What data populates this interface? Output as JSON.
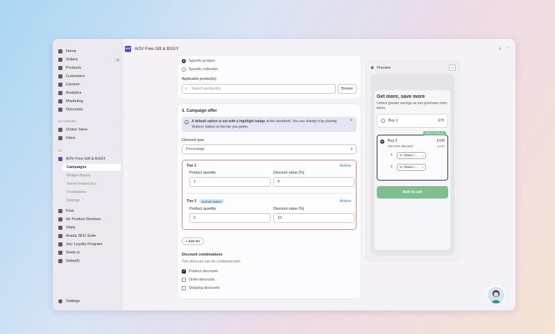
{
  "app": {
    "title": "AOV Free Gift & BXGY",
    "logo_text": "AOV"
  },
  "sidebar": {
    "items": [
      {
        "label": "Home",
        "icon": "home-icon"
      },
      {
        "label": "Orders",
        "icon": "orders-icon",
        "badge": "3"
      },
      {
        "label": "Products",
        "icon": "tag-icon"
      },
      {
        "label": "Customers",
        "icon": "person-icon"
      },
      {
        "label": "Content",
        "icon": "content-icon"
      },
      {
        "label": "Analytics",
        "icon": "chart-icon"
      },
      {
        "label": "Marketing",
        "icon": "target-icon"
      },
      {
        "label": "Discounts",
        "icon": "discount-icon"
      }
    ],
    "sales_channels_heading": "les channels",
    "channels": [
      {
        "label": "Online Store",
        "icon": "store-icon"
      },
      {
        "label": "Inbox",
        "icon": "inbox-icon"
      }
    ],
    "apps_heading": "ps",
    "current_app": {
      "label": "AOV Free Gift & BXGY"
    },
    "subitems": [
      "Campaigns",
      "Widget display",
      "Tiered reward bos",
      "Translations",
      "Settings"
    ],
    "apps": [
      {
        "label": "Flow"
      },
      {
        "label": "Air Product Reviews"
      },
      {
        "label": "Vitals"
      },
      {
        "label": "Avada SEO Suite"
      },
      {
        "label": "Joy: Loyalty Program"
      },
      {
        "label": "Smile.io"
      },
      {
        "label": "Salepify"
      }
    ],
    "settings": "Settings"
  },
  "applies_to": {
    "option_specific_product": "Specific product",
    "option_specific_collection": "Specific collection",
    "selected": "Specific product",
    "products_label": "Applicable product(s)",
    "search_placeholder": "Search product(s)",
    "browse": "Browse"
  },
  "campaign_offer": {
    "heading": "3. Campaign offer",
    "banner_bold": "A default option is set with a highlight badge",
    "banner_rest": " at the storefront. You can change it by clicking 'Actions' button on the tier you prefer.",
    "discount_type_label": "Discount type",
    "discount_type_value": "Percentage",
    "tiers": [
      {
        "title": "Tier 1",
        "badge": "",
        "actions": "Actions",
        "qty_label": "Product quantity",
        "qty": "1",
        "disc_label": "Discount value (%)",
        "disc": "0"
      },
      {
        "title": "Tier 2",
        "badge": "Default option",
        "actions": "Actions",
        "qty_label": "Product quantity",
        "qty": "2",
        "disc_label": "Discount value (%)",
        "disc": "10"
      }
    ],
    "add_tier": "+ Add tier",
    "combinations_heading": "Discount combinations",
    "combinations_sub": "This discount can be combined with:",
    "combinations": [
      {
        "label": "Product discounts",
        "checked": true
      },
      {
        "label": "Order discounts",
        "checked": false
      },
      {
        "label": "Shipping discounts",
        "checked": false
      }
    ]
  },
  "preview": {
    "label": "Preview",
    "title": "Get more, save more",
    "subtitle": "Unlock greater savings as you purchase more items",
    "option1": {
      "label": "Buy 1",
      "price": "£70"
    },
    "option2": {
      "label": "Buy 2",
      "badge": "MOST POPULAR",
      "discount": "Get 10% discount",
      "price": "£126",
      "compare_price": "£140",
      "variants": [
        {
          "n": "1",
          "value": "S / Black / ..."
        },
        {
          "n": "2",
          "value": "S / Black / ..."
        }
      ]
    },
    "add_to_cart": "Add to cart"
  },
  "colors": {
    "accent": "#2c6ecb",
    "highlight_border": "#ef7f7f",
    "add_to_cart": "#7fbe8e"
  }
}
